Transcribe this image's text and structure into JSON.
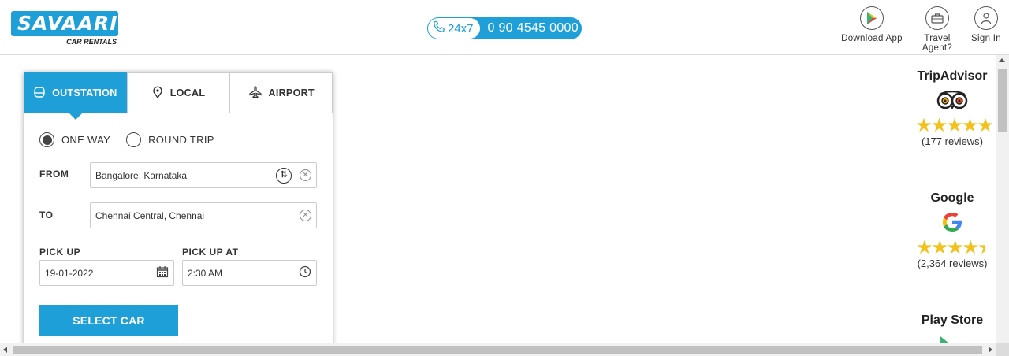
{
  "header": {
    "logo_main": "SAVAARI",
    "logo_sub": "CAR RENTALS",
    "phone_tag": "24x7",
    "phone_number": "0 90 4545 0000",
    "download_app": "Download App",
    "travel_agent": "Travel Agent?",
    "sign_in": "Sign In"
  },
  "booking": {
    "tabs": [
      {
        "label": "OUTSTATION",
        "icon": "taxi-icon",
        "active": true
      },
      {
        "label": "LOCAL",
        "icon": "location-pin-icon",
        "active": false
      },
      {
        "label": "AIRPORT",
        "icon": "airplane-icon",
        "active": false
      }
    ],
    "trip_types": [
      {
        "label": "ONE WAY",
        "selected": true
      },
      {
        "label": "ROUND TRIP",
        "selected": false
      }
    ],
    "from_label": "FROM",
    "from_value": "Bangalore, Karnataka",
    "to_label": "TO",
    "to_value": "Chennai Central, Chennai",
    "pickup_label": "PICK UP",
    "pickup_date": "19-01-2022",
    "pickup_at_label": "PICK UP AT",
    "pickup_time": "2:30 AM",
    "select_button": "SELECT CAR"
  },
  "ratings": [
    {
      "name": "TripAdvisor",
      "reviews": "(177 reviews)",
      "stars": 5
    },
    {
      "name": "Google",
      "reviews": "(2,364 reviews)",
      "stars": 4.5
    },
    {
      "name": "Play Store"
    }
  ],
  "colors": {
    "brand": "#1e9fd8",
    "star": "#f2c11b"
  }
}
